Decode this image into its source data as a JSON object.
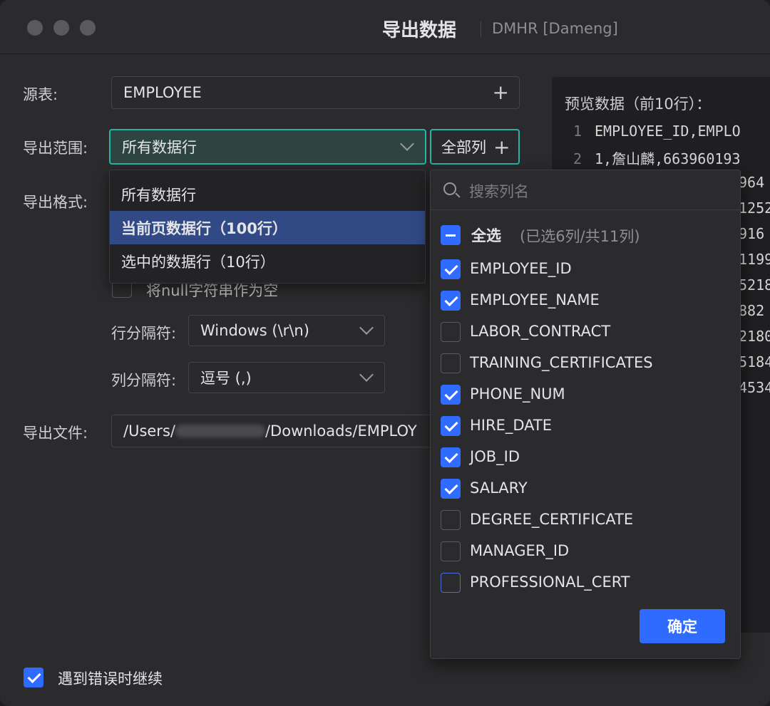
{
  "window": {
    "title": "导出数据",
    "subtitle": "DMHR  [Dameng]"
  },
  "form": {
    "source_table_label": "源表:",
    "source_table_value": "EMPLOYEE",
    "range_label": "导出范围:",
    "range_value": "所有数据行",
    "all_columns_button": "全部列",
    "format_label": "导出格式:",
    "null_option": "将null字符串作为空",
    "row_sep_label": "行分隔符:",
    "row_sep_value": "Windows (\\r\\n)",
    "col_sep_label": "列分隔符:",
    "col_sep_value": "逗号 (,)",
    "file_label": "导出文件:",
    "file_prefix": "/Users/",
    "file_suffix": "/Downloads/EMPLOY",
    "continue_on_error": "遇到错误时继续"
  },
  "range_options": [
    {
      "label": "所有数据行",
      "selected": false
    },
    {
      "label": "当前页数据行（100行）",
      "selected": true
    },
    {
      "label": "选中的数据行（10行）",
      "selected": false
    }
  ],
  "preview": {
    "title": "预览数据（前10行）：",
    "lines": [
      {
        "n": "1",
        "text": "EMPLOYEE_ID,EMPLO"
      },
      {
        "n": "2",
        "text": "1,詹山麟,663960193"
      },
      {
        "n": "",
        "text": "964"
      },
      {
        "n": "",
        "text": "1252"
      },
      {
        "n": "",
        "text": "916"
      },
      {
        "n": "",
        "text": "1199"
      },
      {
        "n": "",
        "text": "5218"
      },
      {
        "n": "",
        "text": "882"
      },
      {
        "n": "",
        "text": "2180"
      },
      {
        "n": "",
        "text": "5184"
      },
      {
        "n": "",
        "text": "4534"
      }
    ]
  },
  "column_chooser": {
    "search_placeholder": "搜索列名",
    "select_all_label": "全选",
    "select_all_count": "(已选6列/共11列)",
    "columns": [
      {
        "name": "EMPLOYEE_ID",
        "checked": true
      },
      {
        "name": "EMPLOYEE_NAME",
        "checked": true
      },
      {
        "name": "LABOR_CONTRACT",
        "checked": false
      },
      {
        "name": "TRAINING_CERTIFICATES",
        "checked": false
      },
      {
        "name": "PHONE_NUM",
        "checked": true
      },
      {
        "name": "HIRE_DATE",
        "checked": true
      },
      {
        "name": "JOB_ID",
        "checked": true
      },
      {
        "name": "SALARY",
        "checked": true
      },
      {
        "name": "DEGREE_CERTIFICATE",
        "checked": false
      },
      {
        "name": "MANAGER_ID",
        "checked": false
      },
      {
        "name": "PROFESSIONAL_CERT",
        "checked": false
      }
    ],
    "confirm_button": "确定"
  },
  "colors": {
    "accent_teal": "#27b3a8",
    "accent_blue": "#2f6bff",
    "selection": "#314a86"
  }
}
